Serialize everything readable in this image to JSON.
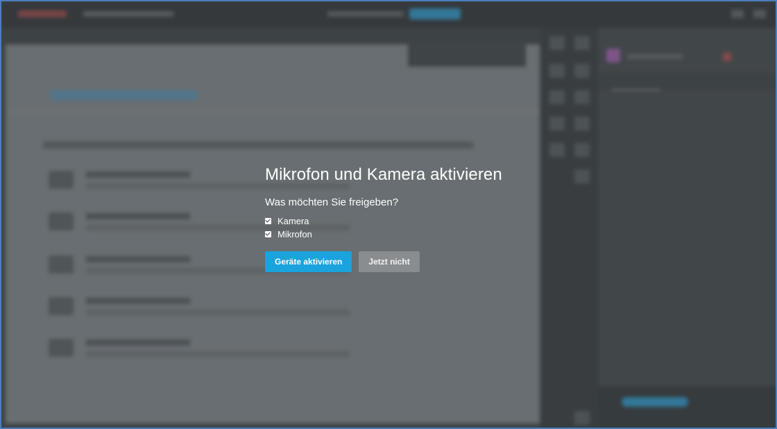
{
  "dialog": {
    "title": "Mikrofon und Kamera aktivieren",
    "question": "Was möchten Sie freigeben?",
    "options": [
      {
        "label": "Kamera",
        "checked": true
      },
      {
        "label": "Mikrofon",
        "checked": true
      }
    ],
    "primary_button": "Geräte aktivieren",
    "secondary_button": "Jetzt nicht"
  },
  "colors": {
    "primary": "#1aa3dd",
    "secondary": "#8a8d90",
    "window_border": "#4a7fc0"
  },
  "icons": [
    "checkbox-checked-icon"
  ]
}
